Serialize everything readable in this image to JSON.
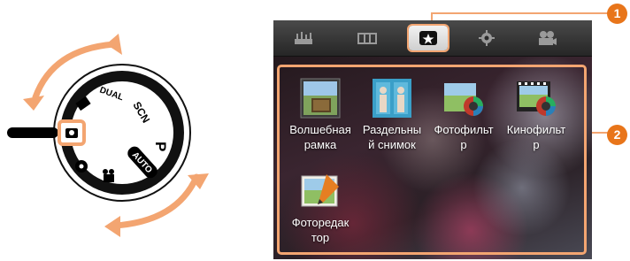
{
  "dial": {
    "labels": {
      "scn": "SCN",
      "p": "P",
      "auto": "AUTO",
      "dual": "DUAL"
    }
  },
  "tabs": [
    {
      "icon": "panorama-plus-icon",
      "active": false
    },
    {
      "icon": "panorama-icon",
      "active": false
    },
    {
      "icon": "magic-star-icon",
      "active": true
    },
    {
      "icon": "settings-gear-icon",
      "active": false
    },
    {
      "icon": "movie-camera-icon",
      "active": false
    }
  ],
  "menu": {
    "items": [
      {
        "label": "Волшебная рамка",
        "icon": "magic-frame-icon"
      },
      {
        "label": "Раздельный снимок",
        "icon": "split-shot-icon"
      },
      {
        "label": "Фотофильтр",
        "icon": "photo-filter-icon"
      },
      {
        "label": "Кинофильтр",
        "icon": "movie-filter-icon"
      },
      {
        "label": "Фоторедактор",
        "icon": "photo-editor-icon"
      }
    ],
    "item_lines": [
      [
        "Волшебная",
        "рамка"
      ],
      [
        "Раздельны",
        "й снимок"
      ],
      [
        "Фотофильт",
        "р"
      ],
      [
        "Кинофильт",
        "р"
      ],
      [
        "Фоторедак",
        "тор"
      ]
    ]
  },
  "callouts": {
    "one": "1",
    "two": "2"
  },
  "colors": {
    "accent": "#f3a571",
    "badge": "#e8751a",
    "dial": "#000000",
    "screen_bar": "#2b2b2b"
  }
}
